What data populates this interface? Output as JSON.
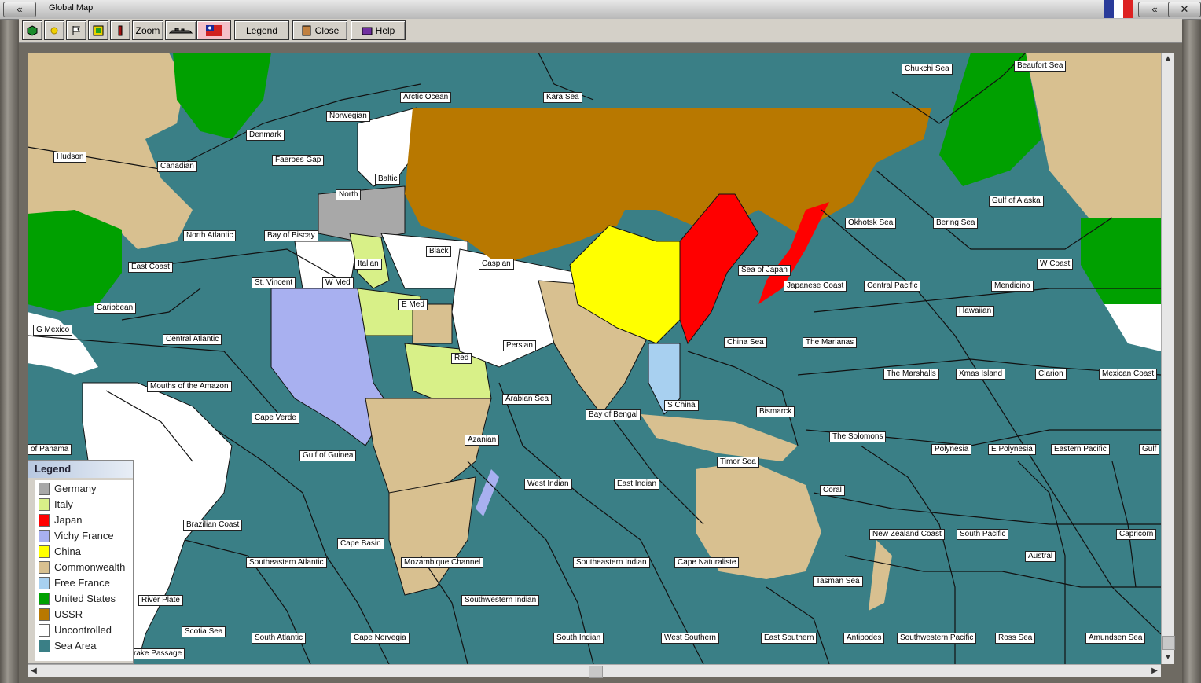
{
  "window": {
    "title": "Global Map"
  },
  "toolbar": {
    "zoom_label": "Zoom",
    "legend_label": "Legend",
    "close_label": "Close",
    "help_label": "Help"
  },
  "legend": {
    "title": "Legend",
    "items": [
      {
        "label": "Germany",
        "color": "#a8a8a8"
      },
      {
        "label": "Italy",
        "color": "#d8f088"
      },
      {
        "label": "Japan",
        "color": "#ff0000"
      },
      {
        "label": "Vichy France",
        "color": "#a8b0f0"
      },
      {
        "label": "China",
        "color": "#ffff00"
      },
      {
        "label": "Commonwealth",
        "color": "#d8c090"
      },
      {
        "label": "Free France",
        "color": "#a8d0f0"
      },
      {
        "label": "United States",
        "color": "#00a000"
      },
      {
        "label": "USSR",
        "color": "#b87800"
      },
      {
        "label": "Uncontrolled",
        "color": "#ffffff"
      },
      {
        "label": "Sea Area",
        "color": "#3a7f86"
      }
    ]
  },
  "sea_areas": [
    "Chukchi Sea",
    "Beaufort Sea",
    "Arctic Ocean",
    "Kara Sea",
    "Norwegian",
    "Denmark",
    "Faeroes Gap",
    "Hudson",
    "Canadian",
    "Baltic",
    "North",
    "Gulf of Alaska",
    "Okhotsk Sea",
    "Bering Sea",
    "North Atlantic",
    "Bay of Biscay",
    "Black",
    "Caspian",
    "East Coast",
    "Italian",
    "Sea of Japan",
    "W Coast",
    "St. Vincent",
    "W Med",
    "Japanese Coast",
    "Central Pacific",
    "Mendicino",
    "Caribbean",
    "E Med",
    "Hawaiian",
    "G Mexico",
    "Central Atlantic",
    "China Sea",
    "The Marianas",
    "Persian",
    "Red",
    "The Marshalls",
    "Xmas Island",
    "Clarion",
    "Mexican Coast",
    "Mouths of the Amazon",
    "Arabian Sea",
    "S China",
    "Bismarck",
    "Bay of Bengal",
    "Cape Verde",
    "Azanian",
    "The Solomons",
    "of Panama",
    "Gulf of Guinea",
    "Polynesia",
    "E Polynesia",
    "Eastern Pacific",
    "Gulf",
    "Timor Sea",
    "West Indian",
    "East Indian",
    "Coral",
    "Brazilian Coast",
    "New Zealand Coast",
    "South Pacific",
    "Capricorn",
    "Cape Basin",
    "Austral",
    "Southeastern Atlantic",
    "Mozambique Channel",
    "Southeastern Indian",
    "Cape Naturaliste",
    "Tasman Sea",
    "River Plate",
    "Southwestern Indian",
    "Scotia Sea",
    "South Atlantic",
    "Cape Norvegia",
    "South Indian",
    "West Southern",
    "East Southern",
    "Antipodes",
    "Southwestern Pacific",
    "Ross Sea",
    "Amundsen Sea",
    "rake Passage"
  ],
  "colors": {
    "sea": "#3a7f86",
    "border": "#111111"
  }
}
